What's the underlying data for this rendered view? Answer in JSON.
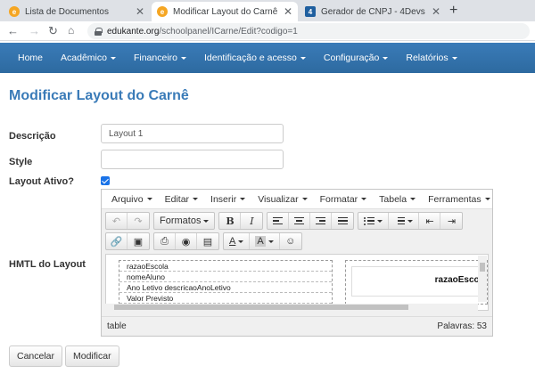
{
  "browser": {
    "tabs": [
      {
        "label": "Lista de Documentos",
        "icon_color": "#f5a623",
        "active": false
      },
      {
        "label": "Modificar Layout do Carnê",
        "icon_color": "#f5a623",
        "active": true
      },
      {
        "label": "Gerador de CNPJ - 4Devs",
        "icon_color": "#1f5f9f",
        "active": false
      }
    ],
    "url_domain": "edukante.org",
    "url_path": "/schoolpanel/ICarne/Edit?codigo=1"
  },
  "nav": {
    "items": [
      {
        "label": "Home",
        "dropdown": false
      },
      {
        "label": "Acadêmico",
        "dropdown": true
      },
      {
        "label": "Financeiro",
        "dropdown": true
      },
      {
        "label": "Identificação e acesso",
        "dropdown": true
      },
      {
        "label": "Configuração",
        "dropdown": true
      },
      {
        "label": "Relatórios",
        "dropdown": true
      }
    ]
  },
  "page": {
    "title": "Modificar Layout do Carnê",
    "labels": {
      "descricao": "Descrição",
      "style": "Style",
      "ativo": "Layout Ativo?",
      "html": "HMTL do Layout"
    },
    "descricao_value": "Layout 1",
    "style_value": "",
    "ativo_checked": true
  },
  "editor": {
    "menus": [
      "Arquivo",
      "Editar",
      "Inserir",
      "Visualizar",
      "Formatar",
      "Tabela",
      "Ferramentas"
    ],
    "formats_label": "Formatos",
    "content_rows": [
      "razaoEscola",
      "nomeAluno",
      "Ano Letivo descricaoAnoLetivo",
      "Valor Previsto"
    ],
    "right_label": "razaoEscola",
    "status_path": "table",
    "status_words": "Palavras: 53"
  },
  "buttons": {
    "cancel": "Cancelar",
    "submit": "Modificar"
  },
  "colors": {
    "nav_bg": "#2d6aa0",
    "title": "#3a7bb8",
    "checkbox": "#1a73e8"
  }
}
